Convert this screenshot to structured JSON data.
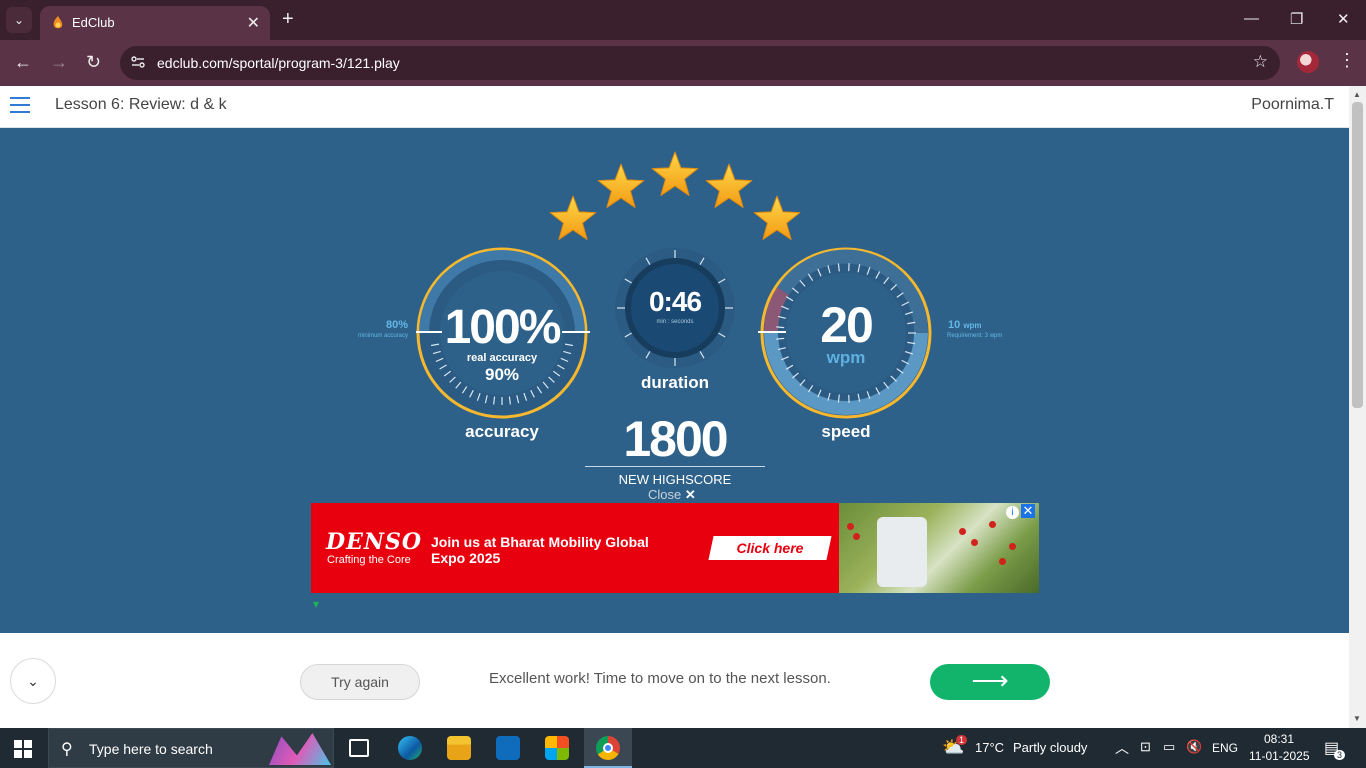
{
  "browser": {
    "tab_title": "EdClub",
    "url": "edclub.com/sportal/program-3/121.play",
    "icons": [
      "tab-search-icon",
      "new-tab-icon",
      "minimize-icon",
      "restore-icon",
      "close-icon",
      "back-icon",
      "forward-icon",
      "reload-icon",
      "site-info-icon",
      "bookmark-star-icon",
      "more-menu-icon"
    ]
  },
  "header": {
    "lesson_title": "Lesson 6: Review: d & k",
    "user_name": "Poornima.T"
  },
  "results": {
    "stars_earned": 5,
    "stars_total": 5,
    "accuracy": {
      "value": "100%",
      "real_label": "real accuracy",
      "real_value": "90%",
      "label": "accuracy",
      "min_value": "80%",
      "min_label": "minimum accuracy"
    },
    "duration": {
      "value": "0:46",
      "units": "min : seconds",
      "label": "duration"
    },
    "speed": {
      "value": "20",
      "unit": "wpm",
      "label": "speed",
      "target_value": "10",
      "target_unit": "wpm",
      "requirement": "Requirement: 3 wpm"
    },
    "score": "1800",
    "score_label": "NEW HIGHSCORE",
    "close_label": "Close"
  },
  "ad": {
    "brand": "DENSO",
    "tagline": "Crafting the Core",
    "headline": "Join us at Bharat Mobility Global Expo 2025",
    "cta": "Click here"
  },
  "footer": {
    "try_again": "Try again",
    "message": "Excellent work! Time to move on to the next lesson.",
    "next_arrow": "⟶"
  },
  "taskbar": {
    "search_placeholder": "Type here to search",
    "weather_temp": "17°C",
    "weather_desc": "Partly cloudy",
    "weather_badge": "1",
    "language": "ENG",
    "time": "08:31",
    "date": "11-01-2025",
    "notifications": "3"
  },
  "colors": {
    "stage_bg": "#2e6189",
    "gauge_ring": "#f5b82e",
    "accent_green": "#12b46b",
    "ad_red": "#e8000f"
  }
}
